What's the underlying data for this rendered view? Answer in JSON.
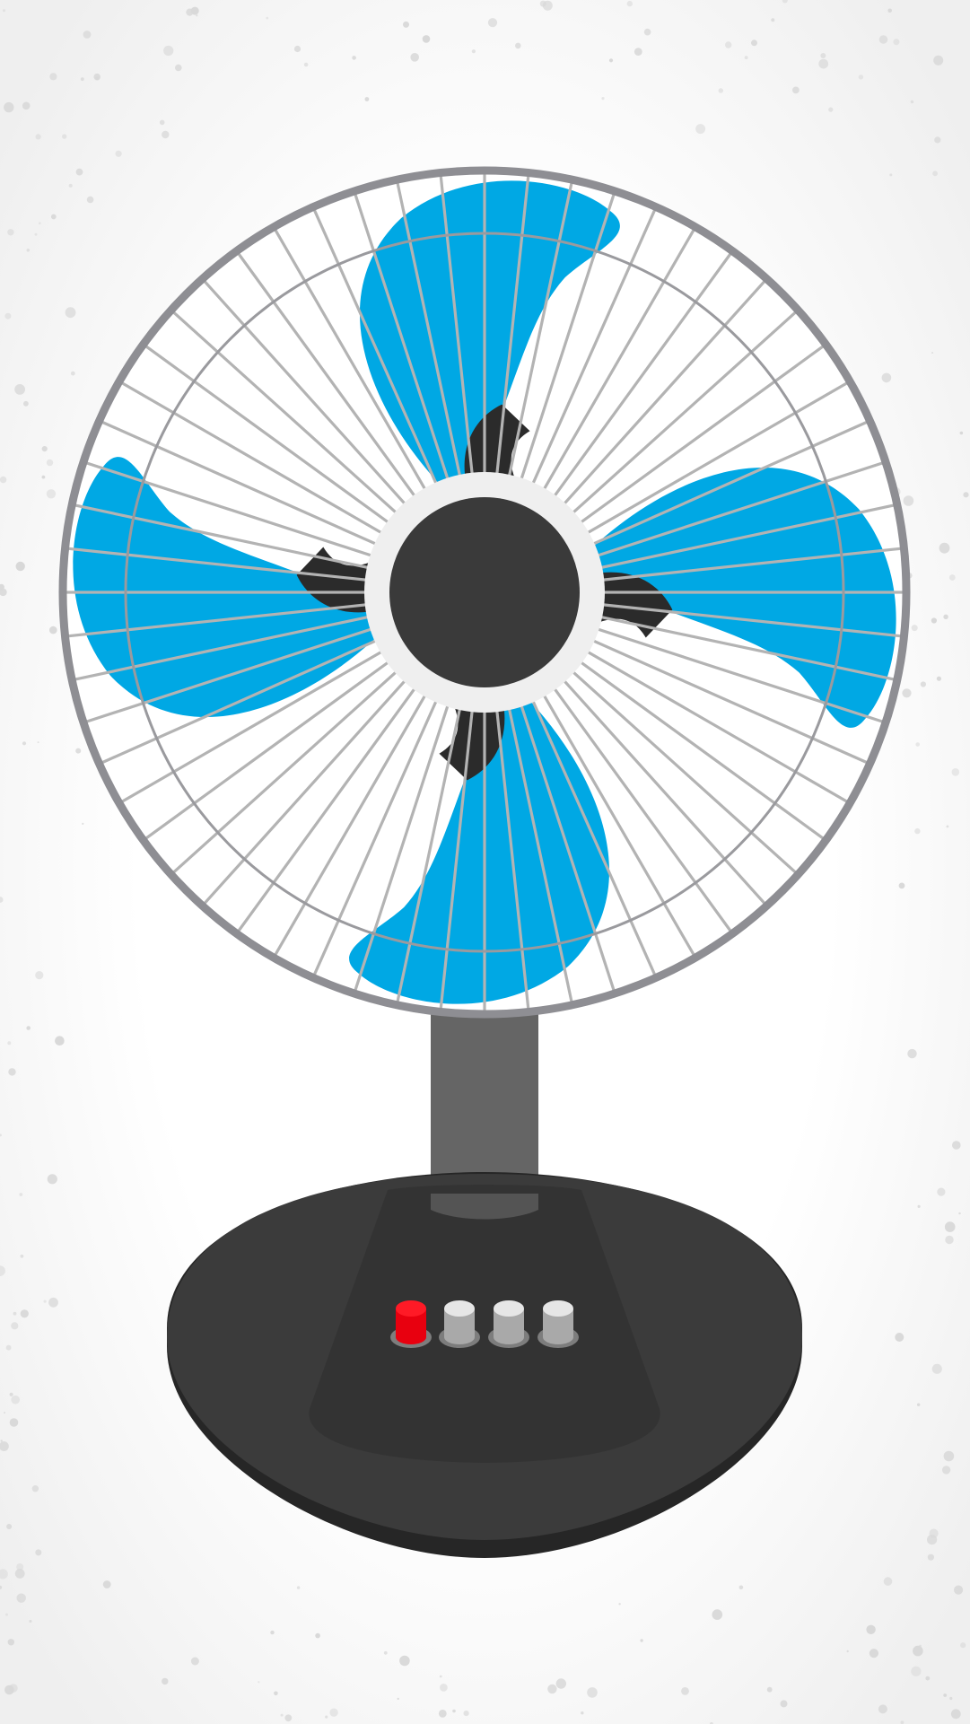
{
  "scene": {
    "subject": "desk-fan",
    "blade_count": 4,
    "button_count": 4,
    "grille_spoke_count": 60
  },
  "colors": {
    "background_center": "#ffffff",
    "background_edge": "#efefef",
    "speckle": "#d8d8d8",
    "blade": "#00a8e4",
    "grille_rim": "#8e8e93",
    "grille_spoke": "#b3b3b3",
    "grille_inner_ring": "#9a9a9e",
    "hub_ring": "#efefef",
    "hub_center": "#3a3a3a",
    "blade_arm": "#2b2b2b",
    "stand": "#656565",
    "stand_shadow": "#545454",
    "base_top": "#3b3b3b",
    "base_panel": "#333333",
    "base_edge": "#262626",
    "button_power": "#e8000f",
    "button_power_top": "#ff1a26",
    "button_speed": "#a9a9a9",
    "button_speed_top": "#e6e6e6",
    "button_ring": "#7d7d7d"
  },
  "buttons": [
    {
      "name": "power-button",
      "color_key": "button_power"
    },
    {
      "name": "speed-1-button",
      "color_key": "button_speed"
    },
    {
      "name": "speed-2-button",
      "color_key": "button_speed"
    },
    {
      "name": "speed-3-button",
      "color_key": "button_speed"
    }
  ]
}
